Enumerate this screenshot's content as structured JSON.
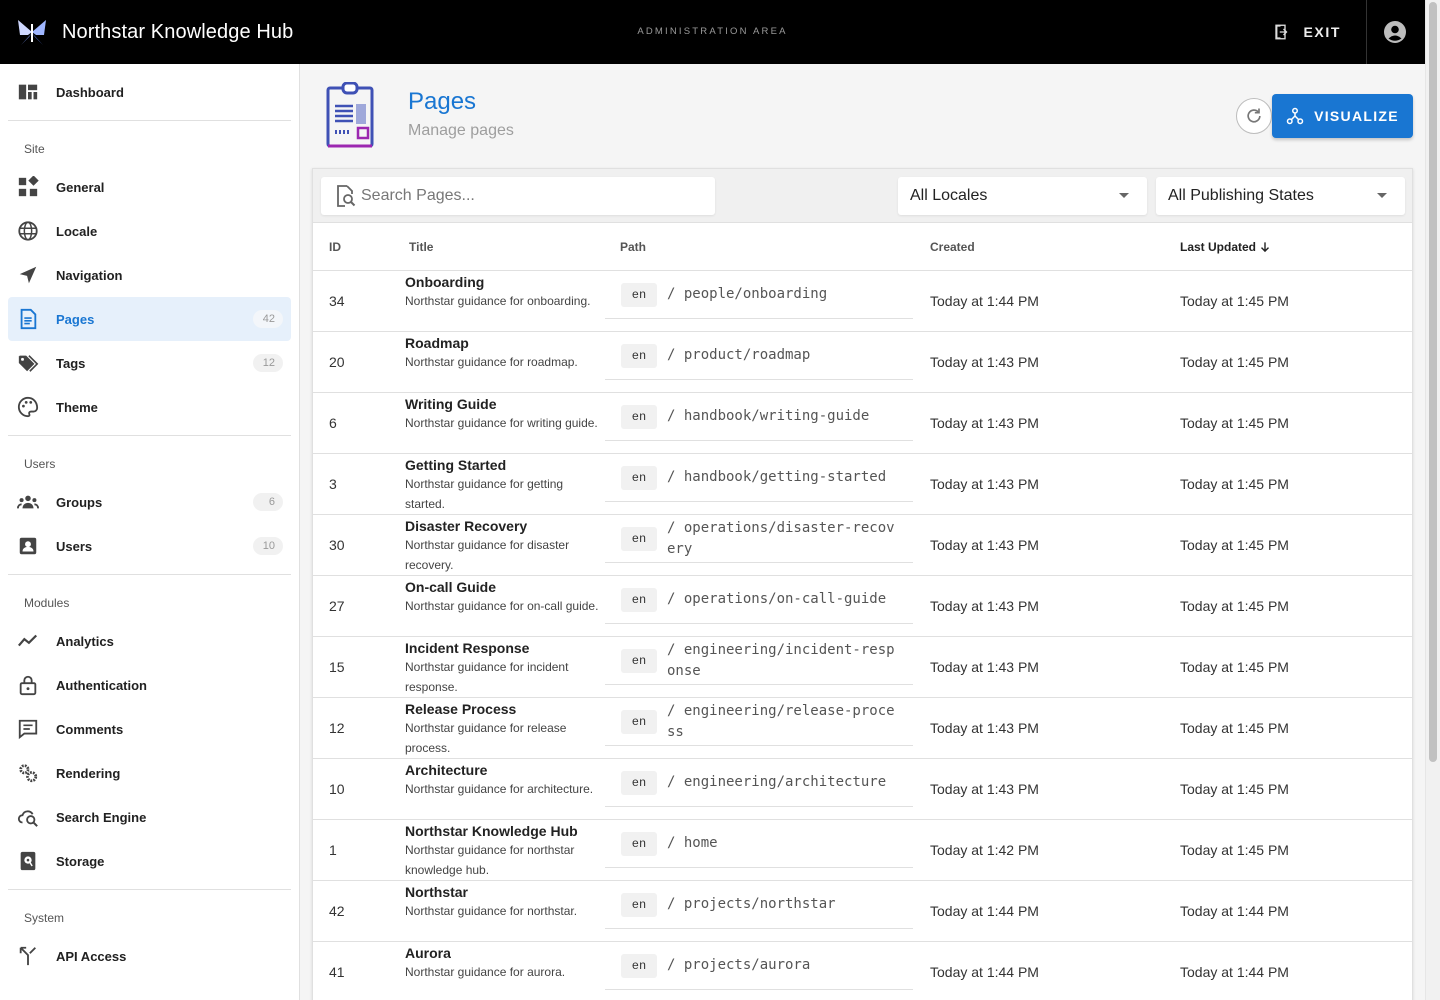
{
  "header": {
    "app_title": "Northstar Knowledge Hub",
    "area_label": "ADMINISTRATION AREA",
    "exit_label": "EXIT"
  },
  "sidebar": {
    "dashboard": {
      "label": "Dashboard",
      "icon": "dashboard-icon"
    },
    "site_header": "Site",
    "site_items": [
      {
        "label": "General",
        "icon": "widgets-icon"
      },
      {
        "label": "Locale",
        "icon": "globe-icon"
      },
      {
        "label": "Navigation",
        "icon": "navigation-arrow-icon"
      },
      {
        "label": "Pages",
        "icon": "page-icon",
        "badge": "42",
        "active": true
      },
      {
        "label": "Tags",
        "icon": "tags-icon",
        "badge": "12"
      },
      {
        "label": "Theme",
        "icon": "palette-icon"
      }
    ],
    "users_header": "Users",
    "users_items": [
      {
        "label": "Groups",
        "icon": "groups-icon",
        "badge": "6"
      },
      {
        "label": "Users",
        "icon": "user-card-icon",
        "badge": "10"
      }
    ],
    "modules_header": "Modules",
    "modules_items": [
      {
        "label": "Analytics",
        "icon": "analytics-icon"
      },
      {
        "label": "Authentication",
        "icon": "lock-icon"
      },
      {
        "label": "Comments",
        "icon": "comment-icon"
      },
      {
        "label": "Rendering",
        "icon": "gears-icon"
      },
      {
        "label": "Search Engine",
        "icon": "cloud-search-icon"
      },
      {
        "label": "Storage",
        "icon": "storage-icon"
      }
    ],
    "system_header": "System",
    "system_items": [
      {
        "label": "API Access",
        "icon": "api-icon"
      }
    ]
  },
  "main": {
    "title": "Pages",
    "subtitle": "Manage pages",
    "visualize_label": "VISUALIZE",
    "search_placeholder": "Search Pages...",
    "locale_filter": "All Locales",
    "state_filter": "All Publishing States"
  },
  "table": {
    "columns": {
      "id": "ID",
      "title": "Title",
      "path": "Path",
      "created": "Created",
      "updated": "Last Updated"
    },
    "rows": [
      {
        "id": "34",
        "title": "Onboarding",
        "desc": "Northstar guidance for onboarding.",
        "locale": "en",
        "path": "/ people/onboarding",
        "created": "Today at 1:44 PM",
        "updated": "Today at 1:45 PM"
      },
      {
        "id": "20",
        "title": "Roadmap",
        "desc": "Northstar guidance for roadmap.",
        "locale": "en",
        "path": "/ product/roadmap",
        "created": "Today at 1:43 PM",
        "updated": "Today at 1:45 PM"
      },
      {
        "id": "6",
        "title": "Writing Guide",
        "desc": "Northstar guidance for writing guide.",
        "locale": "en",
        "path": "/ handbook/writing-guide",
        "created": "Today at 1:43 PM",
        "updated": "Today at 1:45 PM"
      },
      {
        "id": "3",
        "title": "Getting Started",
        "desc": "Northstar guidance for getting started.",
        "locale": "en",
        "path": "/ handbook/getting-started",
        "created": "Today at 1:43 PM",
        "updated": "Today at 1:45 PM"
      },
      {
        "id": "30",
        "title": "Disaster Recovery",
        "desc": "Northstar guidance for disaster recovery.",
        "locale": "en",
        "path": "/ operations/disaster-recovery",
        "created": "Today at 1:43 PM",
        "updated": "Today at 1:45 PM"
      },
      {
        "id": "27",
        "title": "On-call Guide",
        "desc": "Northstar guidance for on-call guide.",
        "locale": "en",
        "path": "/ operations/on-call-guide",
        "created": "Today at 1:43 PM",
        "updated": "Today at 1:45 PM"
      },
      {
        "id": "15",
        "title": "Incident Response",
        "desc": "Northstar guidance for incident response.",
        "locale": "en",
        "path": "/ engineering/incident-response",
        "created": "Today at 1:43 PM",
        "updated": "Today at 1:45 PM"
      },
      {
        "id": "12",
        "title": "Release Process",
        "desc": "Northstar guidance for release process.",
        "locale": "en",
        "path": "/ engineering/release-process",
        "created": "Today at 1:43 PM",
        "updated": "Today at 1:45 PM"
      },
      {
        "id": "10",
        "title": "Architecture",
        "desc": "Northstar guidance for architecture.",
        "locale": "en",
        "path": "/ engineering/architecture",
        "created": "Today at 1:43 PM",
        "updated": "Today at 1:45 PM"
      },
      {
        "id": "1",
        "title": "Northstar Knowledge Hub",
        "desc": "Northstar guidance for northstar knowledge hub.",
        "locale": "en",
        "path": "/ home",
        "created": "Today at 1:42 PM",
        "updated": "Today at 1:45 PM"
      },
      {
        "id": "42",
        "title": "Northstar",
        "desc": "Northstar guidance for northstar.",
        "locale": "en",
        "path": "/ projects/northstar",
        "created": "Today at 1:44 PM",
        "updated": "Today at 1:44 PM"
      },
      {
        "id": "41",
        "title": "Aurora",
        "desc": "Northstar guidance for aurora.",
        "locale": "en",
        "path": "/ projects/aurora",
        "created": "Today at 1:44 PM",
        "updated": "Today at 1:44 PM"
      }
    ]
  }
}
